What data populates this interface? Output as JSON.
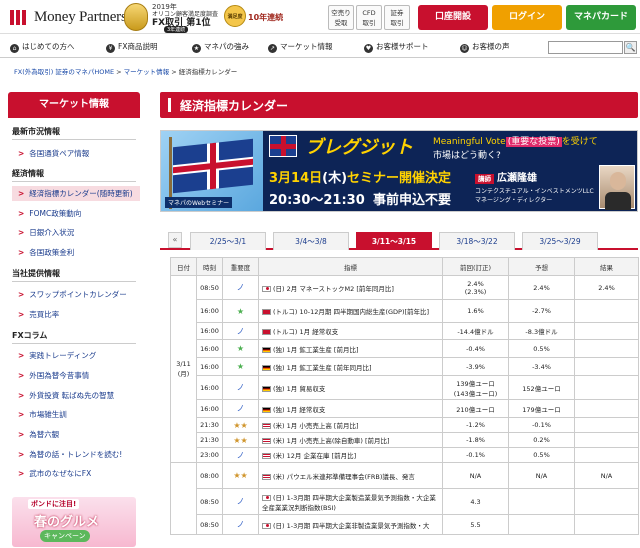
{
  "header": {
    "logo": "Money Partners",
    "award": {
      "year": "2019年",
      "org": "オリコン顧客満足度調査",
      "title": "FX取引 第1位",
      "years": "3年連続",
      "badge": "満足度",
      "streak": "10年連続"
    },
    "top_buttons": [
      {
        "label": "空売り\n受取"
      },
      {
        "label": "CFD\n取引"
      },
      {
        "label": "証券\n取引"
      }
    ],
    "open_account": "口座開設",
    "login": "ログイン",
    "card": "マネパカード",
    "colors": {
      "brand": "#c8102e",
      "login": "#f0a000",
      "card": "#2e9a3a"
    }
  },
  "nav": {
    "items": [
      {
        "label": "はじめての方へ",
        "icon": "home-icon"
      },
      {
        "label": "FX商品説明",
        "icon": "coins-icon"
      },
      {
        "label": "マネパの強み",
        "icon": "star-icon"
      },
      {
        "label": "マーケット情報",
        "icon": "chart-icon"
      },
      {
        "label": "お客様サポート",
        "icon": "heart-icon"
      },
      {
        "label": "お客様の声",
        "icon": "people-icon"
      }
    ],
    "search_button": "🔍"
  },
  "breadcrumb": {
    "l1": "FX(外為取引) 証券のマネパHOME",
    "sep": " > ",
    "l2": "マーケット情報",
    "l3": "経済指標カレンダー"
  },
  "sidebar": {
    "title": "マーケット情報",
    "sec1": "最新市況情報",
    "s1_items": [
      "各国通貨ペア情報"
    ],
    "sec2": "経済情報",
    "s2_items": [
      "経済指標カレンダー(随時更新)",
      "FOMC政策動向",
      "日銀介入状況",
      "各国政策金利"
    ],
    "sec3": "当社提供情報",
    "s3_items": [
      "スワップポイントカレンダー",
      "売買比率"
    ],
    "sec4": "FXコラム",
    "s4_items": [
      "実践トレーディング",
      "外国為替今昔事情",
      "外貨投資 転ばぬ先の智慧",
      "市場雑生訓",
      "為替六観",
      "為替の話・トレンドを読む!",
      "武市のなぜなにFX"
    ],
    "promo": {
      "tag": "ボンドに注目!",
      "main": "春のグルメ",
      "sub": "キャンペーン"
    }
  },
  "main": {
    "title": "経済指標カレンダー",
    "banner": {
      "brexit": "ブレグジット",
      "mv_prefix": "Meaningful Vote",
      "mv_red": "(重要な投票)",
      "mv_suffix": "を受けて",
      "market": "市場はどう動く?",
      "seminar_date": "3月14日",
      "seminar_dow": "(木)",
      "seminar_text": "セミナー開催決定",
      "time": "20:30〜21:30",
      "apply": "事前申込不要",
      "lecturer_tag": "講師",
      "lecturer_name": "広瀬隆雄",
      "lecturer_role1": "コンテクスチュアル・インベストメンツLLC",
      "lecturer_role2": "マネージング・ディレクター",
      "mp_tag": "マネパのWebセミナー"
    },
    "tabs": [
      "2/25〜3/1",
      "3/4〜3/8",
      "3/11〜3/15",
      "3/18〜3/22",
      "3/25〜3/29"
    ],
    "active_tab": 2,
    "prev": "«",
    "columns": [
      "日付",
      "時刻",
      "重要度",
      "指標",
      "前回(訂正)",
      "予想",
      "結果"
    ],
    "date_label": "3/11\n(月)",
    "rows": [
      {
        "time": "08:50",
        "imp": "b",
        "flag": "jp",
        "ind": "(日) 2月 マネーストックM2 [前年同月比]",
        "prev": "2.4%\n(2.3%)",
        "fc": "2.4%",
        "res": "2.4%"
      },
      {
        "time": "16:00",
        "imp": "g",
        "flag": "tr",
        "ind": "(トルコ) 10-12月期 四半期国内総生産(GDP)[前年比]",
        "prev": "1.6%",
        "fc": "-2.7%",
        "res": ""
      },
      {
        "time": "16:00",
        "imp": "b",
        "flag": "tr",
        "ind": "(トルコ) 1月 経常収支",
        "prev": "-14.4億ドル",
        "fc": "-8.3億ドル",
        "res": ""
      },
      {
        "time": "16:00",
        "imp": "g",
        "flag": "de",
        "ind": "(独) 1月 鉱工業生産 [前月比]",
        "prev": "-0.4%",
        "fc": "0.5%",
        "res": ""
      },
      {
        "time": "16:00",
        "imp": "g",
        "flag": "de",
        "ind": "(独) 1月 鉱工業生産 [前年同月比]",
        "prev": "-3.9%",
        "fc": "-3.4%",
        "res": ""
      },
      {
        "time": "16:00",
        "imp": "b",
        "flag": "de",
        "ind": "(独) 1月 貿易収支",
        "prev": "139億ユーロ\n(143億ユーロ)",
        "fc": "152億ユーロ",
        "res": ""
      },
      {
        "time": "16:00",
        "imp": "b",
        "flag": "de",
        "ind": "(独) 1月 経常収支",
        "prev": "210億ユーロ",
        "fc": "179億ユーロ",
        "res": ""
      },
      {
        "time": "21:30",
        "imp": "o",
        "flag": "us",
        "ind": "(米) 1月 小売売上高 [前月比]",
        "prev": "-1.2%",
        "fc": "-0.1%",
        "res": ""
      },
      {
        "time": "21:30",
        "imp": "o",
        "flag": "us",
        "ind": "(米) 1月 小売売上高(除自動車) [前月比]",
        "prev": "-1.8%",
        "fc": "0.2%",
        "res": ""
      },
      {
        "time": "23:00",
        "imp": "b",
        "flag": "us",
        "ind": "(米) 12月 企業在庫 [前月比]",
        "prev": "-0.1%",
        "fc": "0.5%",
        "res": ""
      },
      {
        "time": "08:00",
        "imp": "o",
        "flag": "us",
        "ind": "(米) パウエル米連邦準備理事会(FRB)議長、発言",
        "prev": "N/A",
        "fc": "N/A",
        "res": "N/A"
      },
      {
        "time": "08:50",
        "imp": "b",
        "flag": "jp",
        "ind": "(日) 1-3月期 四半期大企業製造業景気予測指数・大企業全産業業況判断指数(BSI)",
        "prev": "4.3",
        "fc": "",
        "res": ""
      },
      {
        "time": "08:50",
        "imp": "b",
        "flag": "jp",
        "ind": "(日) 1-3月期 四半期大企業非製造業景気予測指数・大",
        "prev": "5.5",
        "fc": "",
        "res": ""
      }
    ]
  }
}
